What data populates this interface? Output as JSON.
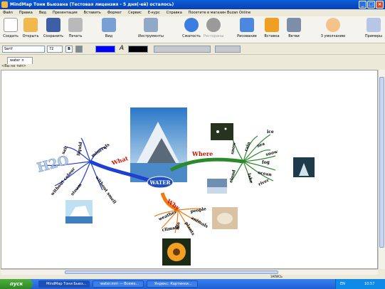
{
  "window": {
    "title": "MindMap Тони Бьюзана (Тестовая лицензия - 5 дня(-ей) осталось)"
  },
  "menu": [
    "Файл",
    "Правка",
    "Вид",
    "Презентация",
    "Вставить",
    "Формат",
    "Сервис",
    "Е-курс",
    "Справка",
    "Посетите в магазин Buzan Online"
  ],
  "toolbar": {
    "create": "Создать",
    "open": "Открыть",
    "save": "Сохранить",
    "print": "Печать",
    "view": "Вид",
    "tools": "Инструменты",
    "shorten": "Сжатость",
    "rest": "Рестораны",
    "drawing": "Рисование",
    "insert": "Вставка",
    "branch": "Ветви",
    "default": "3 умолчанию",
    "more": "Примеры"
  },
  "format": {
    "font": "Serif",
    "size": "72",
    "bold": "B",
    "italic": "A"
  },
  "tab": {
    "label": "water"
  },
  "breadcrumb": "<Вы не тип>",
  "map": {
    "center": "WATER",
    "branches": {
      "what": "What",
      "where": "Where",
      "why": "Why"
    },
    "h2o": "H2O",
    "what_words": [
      "salt",
      "liquid",
      "minerals",
      "without colour",
      "steam",
      "without smell"
    ],
    "where_words": [
      "snow",
      "rain",
      "ice",
      "sea",
      "snow",
      "fog",
      "ocean",
      "cloud",
      "lake",
      "river"
    ],
    "why_words": [
      "weather",
      "climate",
      "life",
      "people",
      "animals",
      "plants"
    ]
  },
  "status": "ЗАПИСЬ",
  "taskbar": {
    "start": "пуск",
    "tasks": [
      "MindMap Тони Бьюз...",
      "water.mm — Всемо...",
      "Яндекс: Картинки..."
    ],
    "lang": "EN",
    "time": "10:57"
  },
  "colors": {
    "blue": "#1f3fd0",
    "green": "#2a8a2a",
    "orange": "#f07a10",
    "red": "#cc1100"
  }
}
